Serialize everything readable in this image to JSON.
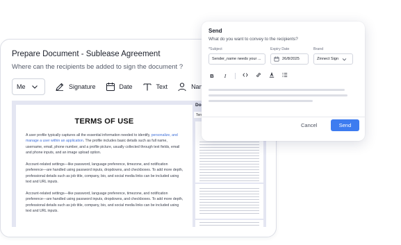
{
  "prepare": {
    "title": "Prepare Document - Sublease Agreement",
    "subtitle": "Where can the recipients be added to sign the document ?",
    "recipient_value": "Me",
    "tools": {
      "signature": "Signature",
      "date": "Date",
      "text": "Text",
      "name": "Name"
    }
  },
  "document": {
    "heading": "TERMS OF USE",
    "p1_before_link": "A user profile typically captures all the essential information needed to identify, ",
    "p1_link": "personalize, and manage a user within an application",
    "p1_after_link": ". The profile includes basic details such as full name, username, email, phone number, and a profile picture, usually collected through text fields, email and phone inputs, and an image upload option.",
    "p2": "Account-related settings—like password, language preference, timezone, and notification preference—are handled using password inputs, dropdowns, and checkboxes. To add more depth, professional details such as job title, company, bio, and social media links can be included using text and URL inputs.",
    "p3": "Account-related settings—like password, language preference, timezone, and notification preference—are handled using password inputs, dropdowns, and checkboxes. To add more depth, professional details such as job title, company, bio, and social media links can be included using text and URL inputs."
  },
  "thumbnails": {
    "heading": "Docu",
    "bar_label": "Term"
  },
  "send": {
    "title": "Send",
    "subtitle": "What do you want to convey to the recipients?",
    "subject_label": "*Subject",
    "subject_value": "Sender_name needs your ...",
    "expiry_label": "Expiry Date",
    "expiry_value": "26/8/2025",
    "brand_label": "Brand",
    "brand_value": "Zinnect Sign",
    "cancel_label": "Cancel",
    "send_label": "Send"
  },
  "colors": {
    "accent": "#3d7cf0",
    "link": "#3f6fd8",
    "doc_background": "#e4e6f2"
  }
}
